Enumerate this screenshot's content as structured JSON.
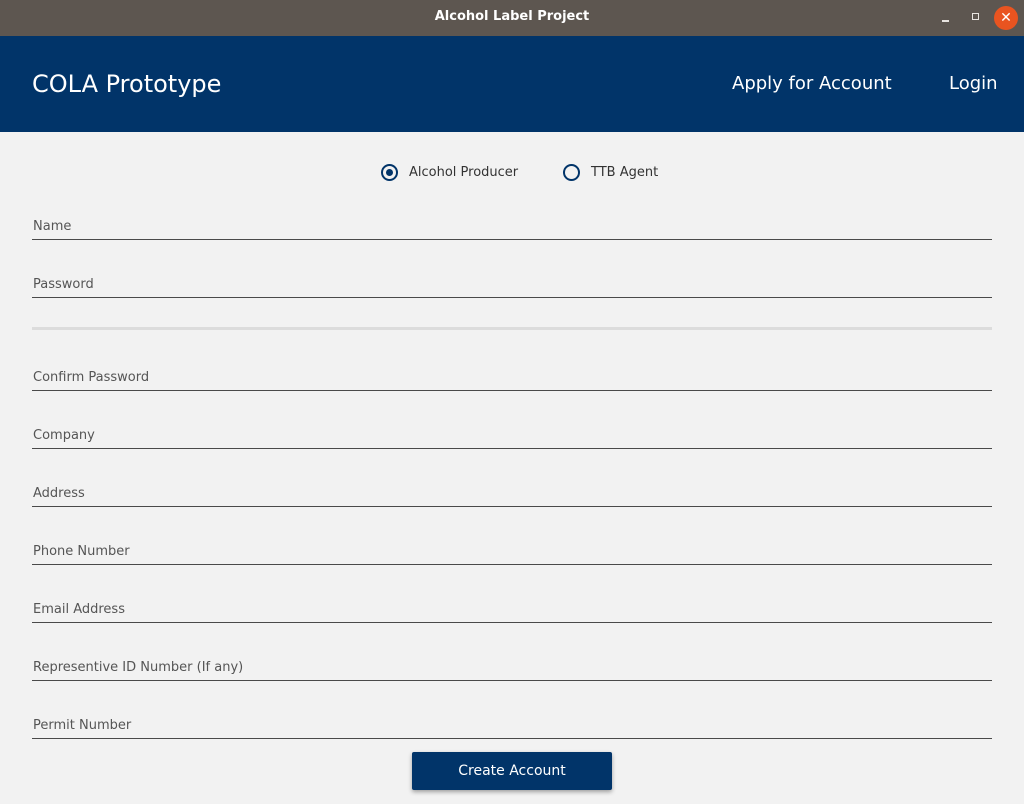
{
  "window": {
    "title": "Alcohol Label Project",
    "close_glyph": "✕"
  },
  "appbar": {
    "brand": "COLA Prototype",
    "nav": {
      "apply": "Apply for Account",
      "login": "Login"
    }
  },
  "account_type": {
    "options": [
      {
        "label": "Alcohol Producer",
        "checked": true
      },
      {
        "label": "TTB Agent",
        "checked": false
      }
    ]
  },
  "form": {
    "name": "Name",
    "password": "Password",
    "confirm_password": "Confirm Password",
    "company": "Company",
    "address": "Address",
    "phone": "Phone Number",
    "email": "Email Address",
    "rep_id": "Representive ID Number (If any)",
    "permit": "Permit Number",
    "submit": "Create Account"
  },
  "colors": {
    "brand": "#013469",
    "background": "#f2f2f2",
    "titlebar": "#5d5650",
    "close": "#e95420"
  }
}
